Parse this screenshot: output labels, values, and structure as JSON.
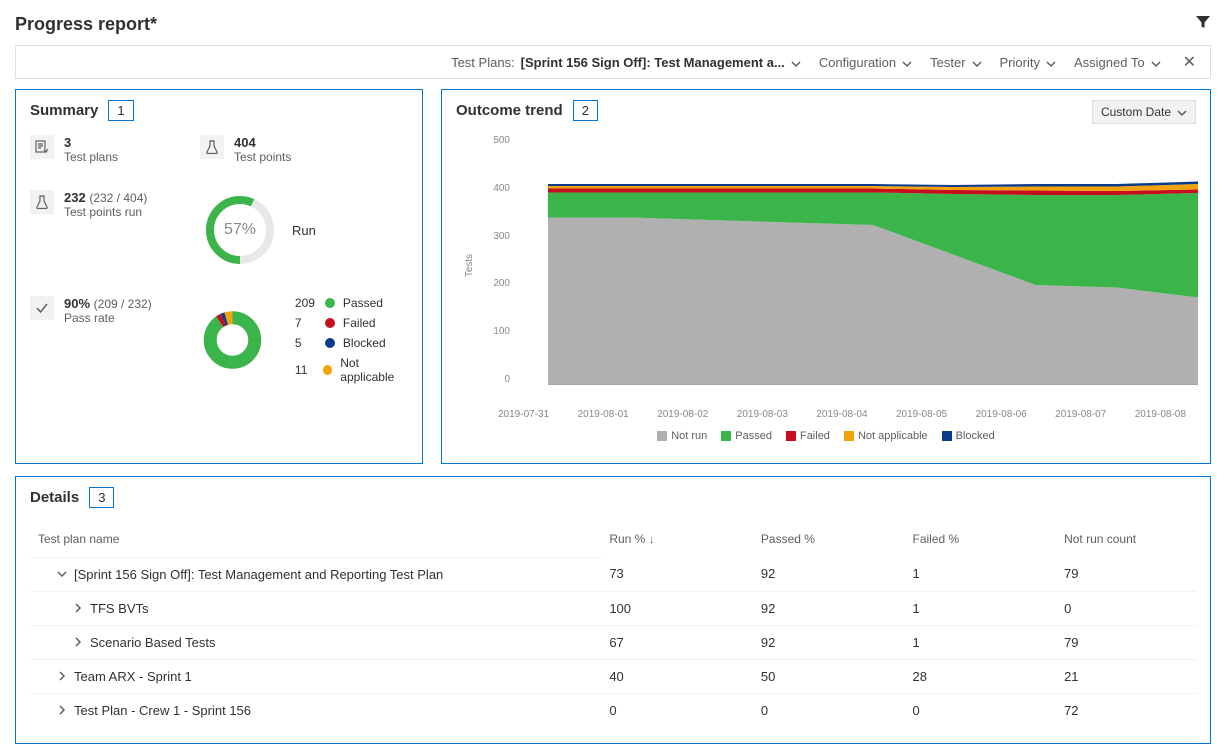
{
  "page_title": "Progress report*",
  "filter_bar": {
    "test_plans_label": "Test Plans:",
    "test_plans_value": "[Sprint 156 Sign Off]: Test Management a...",
    "items": [
      "Configuration",
      "Tester",
      "Priority",
      "Assigned To"
    ]
  },
  "summary": {
    "title": "Summary",
    "badge": "1",
    "test_plans_value": "3",
    "test_plans_label": "Test plans",
    "test_points_value": "404",
    "test_points_label": "Test points",
    "run_value": "232",
    "run_frac": "(232 / 404)",
    "run_label_text": "Test points run",
    "run_gauge_pct": "57%",
    "run_gauge_label": "Run",
    "pass_value": "90%",
    "pass_frac": "(209 / 232)",
    "pass_label": "Pass rate",
    "donut_legend": [
      {
        "count": "209",
        "color": "#3bb44a",
        "label": "Passed"
      },
      {
        "count": "7",
        "color": "#c50f1f",
        "label": "Failed"
      },
      {
        "count": "5",
        "color": "#0b3c8c",
        "label": "Blocked"
      },
      {
        "count": "11",
        "color": "#f2a30b",
        "label": "Not applicable"
      }
    ]
  },
  "trend": {
    "title": "Outcome trend",
    "badge": "2",
    "date_btn": "Custom Date",
    "y_axis_label": "Tests",
    "y_ticks": [
      "500",
      "400",
      "300",
      "200",
      "100",
      "0"
    ],
    "x_ticks": [
      "2019-07-31",
      "2019-08-01",
      "2019-08-02",
      "2019-08-03",
      "2019-08-04",
      "2019-08-05",
      "2019-08-06",
      "2019-08-07",
      "2019-08-08"
    ],
    "legend": [
      {
        "color": "#b0b0b0",
        "label": "Not run"
      },
      {
        "color": "#3bb44a",
        "label": "Passed"
      },
      {
        "color": "#c50f1f",
        "label": "Failed"
      },
      {
        "color": "#f2a30b",
        "label": "Not applicable"
      },
      {
        "color": "#0b3c8c",
        "label": "Blocked"
      }
    ]
  },
  "details": {
    "title": "Details",
    "badge": "3",
    "columns": [
      "Test plan name",
      "Run %",
      "Passed %",
      "Failed %",
      "Not run count"
    ],
    "rows": [
      {
        "caret": "v",
        "indent": "indent1",
        "name": "[Sprint 156 Sign Off]: Test Management and Reporting Test Plan",
        "run": "73",
        "passed": "92",
        "failed": "1",
        "notrun": "79"
      },
      {
        "caret": ">",
        "indent": "indent2",
        "name": "TFS BVTs",
        "run": "100",
        "passed": "92",
        "failed": "1",
        "notrun": "0"
      },
      {
        "caret": ">",
        "indent": "indent2",
        "name": "Scenario Based Tests",
        "run": "67",
        "passed": "92",
        "failed": "1",
        "notrun": "79"
      },
      {
        "caret": ">",
        "indent": "indent1",
        "name": "Team ARX - Sprint 1",
        "run": "40",
        "passed": "50",
        "failed": "28",
        "notrun": "21"
      },
      {
        "caret": ">",
        "indent": "indent1",
        "name": "Test Plan - Crew 1 - Sprint 156",
        "run": "0",
        "passed": "0",
        "failed": "0",
        "notrun": "72"
      }
    ]
  },
  "chart_data": {
    "type": "area",
    "title": "Outcome trend",
    "xlabel": "",
    "ylabel": "Tests",
    "ylim": [
      0,
      500
    ],
    "x": [
      "2019-07-31",
      "2019-08-01",
      "2019-08-02",
      "2019-08-03",
      "2019-08-04",
      "2019-08-05",
      "2019-08-06",
      "2019-08-07",
      "2019-08-08"
    ],
    "series": [
      {
        "name": "Not run",
        "color": "#b0b0b0",
        "values": [
          335,
          335,
          330,
          325,
          320,
          260,
          200,
          195,
          175
        ]
      },
      {
        "name": "Passed",
        "color": "#3bb44a",
        "values": [
          50,
          50,
          55,
          60,
          65,
          122,
          180,
          185,
          209
        ]
      },
      {
        "name": "Failed",
        "color": "#c50f1f",
        "values": [
          8,
          8,
          8,
          8,
          8,
          8,
          9,
          8,
          7
        ]
      },
      {
        "name": "Not applicable",
        "color": "#f2a30b",
        "values": [
          5,
          5,
          5,
          5,
          5,
          6,
          8,
          9,
          11
        ]
      },
      {
        "name": "Blocked",
        "color": "#0b3c8c",
        "values": [
          4,
          4,
          4,
          4,
          4,
          4,
          5,
          5,
          5
        ]
      }
    ]
  }
}
